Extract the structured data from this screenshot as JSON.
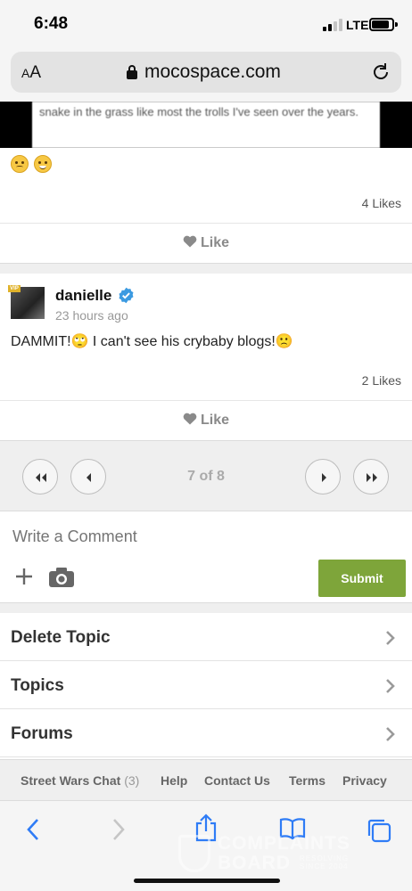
{
  "status": {
    "time": "6:48",
    "network": "LTE",
    "battery_level": 0.85
  },
  "browser": {
    "text_size_label": "AA",
    "url": "mocospace.com"
  },
  "previous_post": {
    "quote_text": "snake in the grass like most the trolls I've seen over the years.",
    "emojis": [
      "frown",
      "grin"
    ],
    "likes": "4 Likes",
    "like_label": "Like"
  },
  "post": {
    "username": "danielle",
    "badge": "VIP",
    "time_ago": "23 hours ago",
    "text": "DAMMIT!🙄 I can't see his crybaby blogs!🙁",
    "likes": "2 Likes",
    "like_label": "Like"
  },
  "pager": {
    "label": "7 of 8"
  },
  "comment": {
    "placeholder": "Write a Comment",
    "submit_label": "Submit"
  },
  "nav": {
    "items": [
      {
        "label": "Delete Topic"
      },
      {
        "label": "Topics"
      },
      {
        "label": "Forums"
      }
    ]
  },
  "footer": {
    "links": [
      {
        "label": "Street Wars Chat",
        "count": "(3)"
      },
      {
        "label": "Help"
      },
      {
        "label": "Contact Us"
      },
      {
        "label": "Terms"
      },
      {
        "label": "Privacy"
      }
    ]
  },
  "watermark": {
    "line1": "COMPLAINTS",
    "line2": "BOARD",
    "tagline1": "RESOLVING",
    "tagline2": "SINCE 2004"
  },
  "colors": {
    "submit": "#7ea53a",
    "verified": "#3b9ae1",
    "link_blue": "#2f7cf6"
  },
  "icons": [
    "lock-icon",
    "reload-icon",
    "heart-icon",
    "verified-icon",
    "first-page-icon",
    "prev-page-icon",
    "next-page-icon",
    "last-page-icon",
    "plus-icon",
    "camera-icon",
    "chevron-right-icon",
    "back-icon",
    "forward-icon",
    "share-icon",
    "bookmarks-icon",
    "tabs-icon"
  ]
}
